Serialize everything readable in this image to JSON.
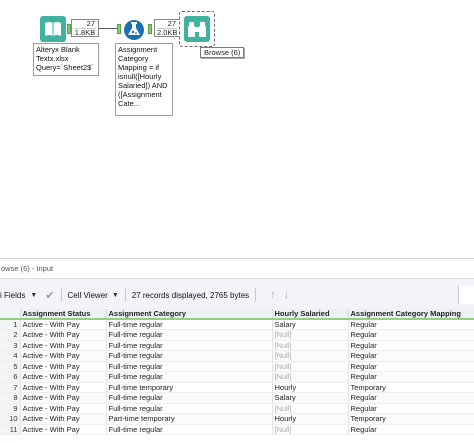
{
  "canvas": {
    "input_tool": {
      "icon": "book-icon",
      "records": "27",
      "size": "1.8KB",
      "annotation": "Alteryx Blank\nTextx.xlsx\nQuery=`Sheet2$`"
    },
    "formula_tool": {
      "icon": "flask-icon",
      "records": "27",
      "size": "2.0KB",
      "annotation": "Assignment\nCategory\nMapping = if\nisnull([Hourly\nSalaried]) AND\n([Assignment\nCate..."
    },
    "browse_tool": {
      "icon": "binoculars-icon",
      "label": "Browse (6)"
    }
  },
  "results": {
    "title": "owse (6) - Input",
    "toolbar": {
      "fields_label": "i Fields",
      "viewer_label": "Cell Viewer",
      "status": "27 records displayed, 2765 bytes"
    },
    "columns": [
      "",
      "Assignment Status",
      "Assignment Category",
      "Hourly Salaried",
      "Assignment Category Mapping"
    ],
    "rows": [
      [
        "1",
        "Active - With Pay",
        "Full-time regular",
        "Salary",
        "Regular"
      ],
      [
        "2",
        "Active - With Pay",
        "Full-time regular",
        "[Null]",
        "Regular"
      ],
      [
        "3",
        "Active - With Pay",
        "Full-time regular",
        "[Null]",
        "Regular"
      ],
      [
        "4",
        "Active - With Pay",
        "Full-time regular",
        "[Null]",
        "Regular"
      ],
      [
        "5",
        "Active - With Pay",
        "Full-time regular",
        "[Null]",
        "Regular"
      ],
      [
        "6",
        "Active - With Pay",
        "Full-time regular",
        "[Null]",
        "Regular"
      ],
      [
        "7",
        "Active - With Pay",
        "Full-time temporary",
        "Hourly",
        "Temporary"
      ],
      [
        "8",
        "Active - With Pay",
        "Full-time regular",
        "Salary",
        "Regular"
      ],
      [
        "9",
        "Active - With Pay",
        "Full-time regular",
        "[Null]",
        "Regular"
      ],
      [
        "10",
        "Active - With Pay",
        "Part-time temporary",
        "Hourly",
        "Temporary"
      ],
      [
        "11",
        "Active - With Pay",
        "Full-time regular",
        "[Null]",
        "Regular"
      ]
    ]
  }
}
